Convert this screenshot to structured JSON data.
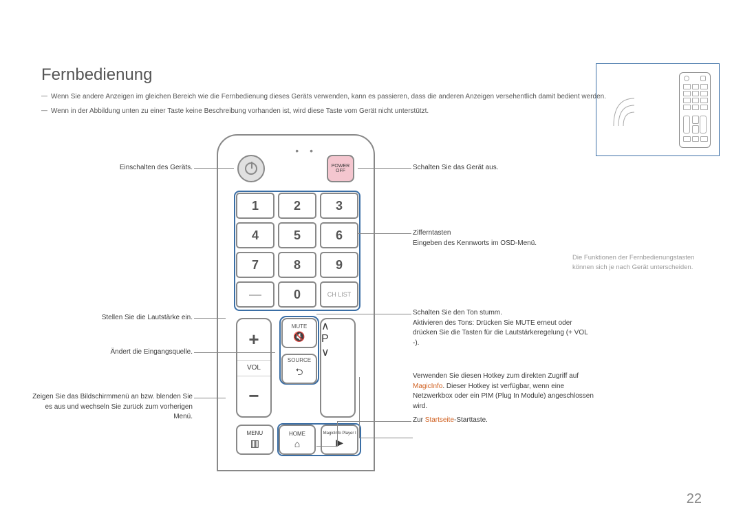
{
  "heading": "Fernbedienung",
  "notes": [
    "Wenn Sie andere Anzeigen im gleichen Bereich wie die Fernbedienung dieses Geräts verwenden, kann es passieren, dass die anderen Anzeigen versehentlich damit bedient werden.",
    "Wenn in der Abbildung unten zu einer Taste keine Beschreibung vorhanden ist, wird diese Taste vom Gerät nicht unterstützt."
  ],
  "note_marker": "―",
  "remote": {
    "off_label": "POWER OFF",
    "keypad": [
      "1",
      "2",
      "3",
      "4",
      "5",
      "6",
      "7",
      "8",
      "9",
      "—",
      "0",
      "CH LIST"
    ],
    "vol_plus": "+",
    "vol_minus": "−",
    "vol_label": "VOL",
    "mute_label": "MUTE",
    "source_label": "SOURCE",
    "ch_label": "P",
    "menu_label": "MENU",
    "home_label": "HOME",
    "magic_label": "MagicInfo Player I"
  },
  "callouts": {
    "left": {
      "power": "Einschalten des Geräts.",
      "volume": "Stellen Sie die Lautstärke ein.",
      "source": "Ändert die Eingangsquelle.",
      "menu": "Zeigen Sie das Bildschirmmenü an bzw. blenden Sie es aus und wechseln Sie zurück zum vorherigen Menü."
    },
    "right": {
      "off": "Schalten Sie das Gerät aus.",
      "digits_l1": "Zifferntasten",
      "digits_l2": "Eingeben des Kennworts im OSD-Menü.",
      "mute_l1": "Schalten Sie den Ton stumm.",
      "mute_l2": "Aktivieren des Tons: Drücken Sie MUTE erneut oder drücken Sie die Tasten für die Lautstärkeregelung (+ VOL -).",
      "magic_l1_a": "Verwenden Sie diesen Hotkey zum direkten Zugriff auf ",
      "magic_l1_hl": "MagicInfo",
      "magic_l1_b": ". Dieser Hotkey ist verfügbar, wenn eine Netzwerkbox oder ein PIM (Plug In Module) angeschlossen wird.",
      "home_pre": "Zur ",
      "home_hl": "Startseite",
      "home_post": "-Starttaste."
    }
  },
  "sidenote": "Die Funktionen der Fernbedienungstasten können sich je nach Gerät unterscheiden.",
  "page_number": "22"
}
